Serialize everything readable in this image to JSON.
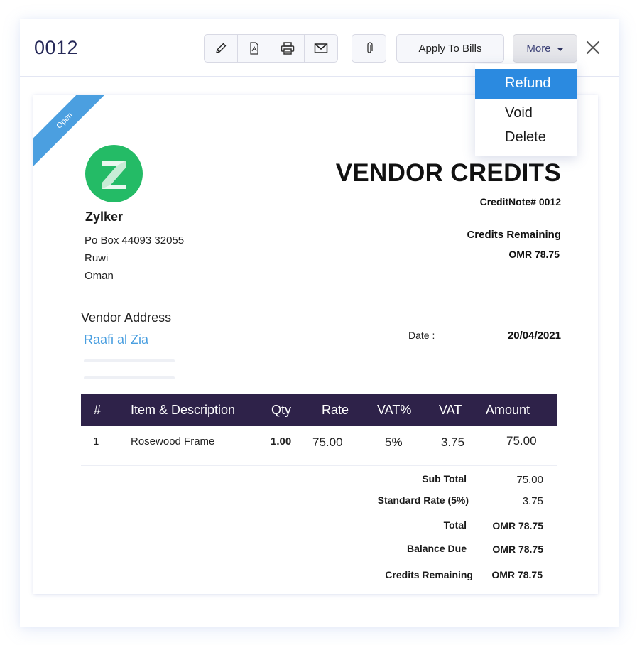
{
  "header": {
    "doc_number": "0012",
    "toolbar_icons": [
      "pencil-icon",
      "pdf-icon",
      "printer-icon",
      "mail-icon"
    ],
    "attach_icon": "paperclip-icon",
    "apply_label": "Apply To Bills",
    "more_label": "More",
    "close_icon": "close-icon"
  },
  "dropdown": {
    "items": [
      {
        "label": "Refund",
        "active": true
      },
      {
        "label": "Void",
        "active": false
      },
      {
        "label": "Delete",
        "active": false
      }
    ]
  },
  "document": {
    "status_ribbon": "Open",
    "logo_letter": "Z",
    "company_name": "Zylker",
    "address_lines": [
      "Po Box 44093 32055",
      "Ruwi",
      "Oman"
    ],
    "title": "VENDOR CREDITS",
    "credit_note_label": "CreditNote# 0012",
    "credits_remaining_label": "Credits Remaining",
    "credits_remaining_value": "OMR 78.75",
    "vendor_address_label": "Vendor Address",
    "vendor_name": "Raafi al Zia",
    "date_label": "Date :",
    "date_value": "20/04/2021",
    "table": {
      "columns": [
        "#",
        "Item & Description",
        "Qty",
        "Rate",
        "VAT%",
        "VAT",
        "Amount"
      ],
      "rows": [
        {
          "num": "1",
          "item": "Rosewood Frame",
          "qty": "1.00",
          "rate": "75.00",
          "vat_pct": "5%",
          "vat": "3.75",
          "amount": "75.00"
        }
      ]
    },
    "totals": [
      {
        "label": "Sub Total",
        "value": "75.00"
      },
      {
        "label": "Standard Rate (5%)",
        "value": "3.75"
      },
      {
        "label": "Total",
        "value": "OMR 78.75"
      },
      {
        "label": "Balance Due",
        "value": "OMR 78.75"
      },
      {
        "label": "Credits Remaining",
        "value": "OMR 78.75"
      }
    ]
  },
  "colors": {
    "accent_blue": "#2b8ae0",
    "ribbon_blue": "#4b9fe0",
    "table_header": "#2e2249",
    "logo_green": "#24bb66",
    "vendor_link": "#4a9fe0",
    "doc_number": "#272a59"
  }
}
